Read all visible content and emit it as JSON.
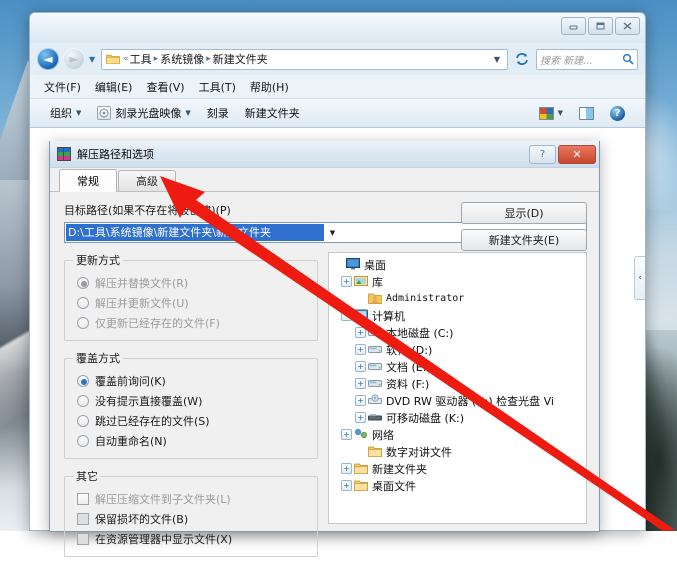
{
  "window": {
    "controls": {
      "minimize": "–",
      "maximize": "□",
      "close": "✕"
    },
    "address": {
      "chevron": "«",
      "crumbs": [
        "工具",
        "系统镜像",
        "新建文件夹"
      ],
      "separator": "▸",
      "dropdown_caret": "▼",
      "refresh_icon": "refresh-icon"
    },
    "search": {
      "placeholder": "搜索 新建...",
      "icon": "search-icon"
    },
    "menubar": [
      "文件(F)",
      "编辑(E)",
      "查看(V)",
      "工具(T)",
      "帮助(H)"
    ],
    "toolbar": {
      "organize": "组织",
      "burn_image": "刻录光盘映像",
      "burn": "刻录",
      "new_folder": "新建文件夹",
      "caret": "▼",
      "help_glyph": "?"
    },
    "pane_collapse_glyph": "‹"
  },
  "dialog": {
    "title": "解压路径和选项",
    "help_glyph": "?",
    "close_glyph": "✕",
    "tabs": [
      {
        "label": "常规",
        "active": true
      },
      {
        "label": "高级",
        "active": false
      }
    ],
    "path_label": "目标路径(如果不存在将被创建)(P)",
    "path_value": "D:\\工具\\系统镜像\\新建文件夹\\新建文件夹",
    "path_caret": "▼",
    "buttons": {
      "show": "显示(D)",
      "new_folder": "新建文件夹(E)"
    },
    "groups": {
      "update_mode": {
        "legend": "更新方式",
        "options": [
          {
            "label": "解压并替换文件(R)",
            "selected": true,
            "disabled": true
          },
          {
            "label": "解压并更新文件(U)",
            "selected": false,
            "disabled": true
          },
          {
            "label": "仅更新已经存在的文件(F)",
            "selected": false,
            "disabled": true
          }
        ]
      },
      "overwrite_mode": {
        "legend": "覆盖方式",
        "options": [
          {
            "label": "覆盖前询问(K)",
            "selected": true,
            "disabled": false
          },
          {
            "label": "没有提示直接覆盖(W)",
            "selected": false,
            "disabled": false
          },
          {
            "label": "跳过已经存在的文件(S)",
            "selected": false,
            "disabled": false
          },
          {
            "label": "自动重命名(N)",
            "selected": false,
            "disabled": false
          }
        ]
      },
      "other": {
        "legend": "其它",
        "options": [
          {
            "label": "解压压缩文件到子文件夹(L)",
            "checked": false,
            "disabled": true
          },
          {
            "label": "保留损坏的文件(B)",
            "checked": false,
            "disabled": false
          },
          {
            "label": "在资源管理器中显示文件(X)",
            "checked": false,
            "disabled": false
          }
        ]
      }
    },
    "tree": [
      {
        "label": "桌面",
        "indent": 0,
        "expander": "",
        "icon": "desktop-icon"
      },
      {
        "label": "库",
        "indent": 1,
        "expander": "+",
        "icon": "library-icon"
      },
      {
        "label": "Administrator",
        "indent": 1,
        "expander": "",
        "icon": "user-folder-icon",
        "mono": true
      },
      {
        "label": "计算机",
        "indent": 1,
        "expander": "-",
        "icon": "computer-icon"
      },
      {
        "label": "本地磁盘 (C:)",
        "indent": 2,
        "expander": "+",
        "icon": "drive-system-icon"
      },
      {
        "label": "软件 (D:)",
        "indent": 2,
        "expander": "+",
        "icon": "drive-icon"
      },
      {
        "label": "文档 (E:)",
        "indent": 2,
        "expander": "+",
        "icon": "drive-icon"
      },
      {
        "label": "资料 (F:)",
        "indent": 2,
        "expander": "+",
        "icon": "drive-icon"
      },
      {
        "label": "DVD RW 驱动器 (G:) 检查光盘 Vi",
        "indent": 2,
        "expander": "+",
        "icon": "dvd-icon"
      },
      {
        "label": "可移动磁盘 (K:)",
        "indent": 2,
        "expander": "+",
        "icon": "removable-icon"
      },
      {
        "label": "网络",
        "indent": 1,
        "expander": "+",
        "icon": "network-icon"
      },
      {
        "label": "数字对讲文件",
        "indent": 1,
        "expander": "",
        "icon": "folder-icon"
      },
      {
        "label": "新建文件夹",
        "indent": 1,
        "expander": "+",
        "icon": "folder-icon"
      },
      {
        "label": "桌面文件",
        "indent": 1,
        "expander": "+",
        "icon": "folder-icon"
      }
    ]
  },
  "colors": {
    "selection_blue": "#2f6fce",
    "radio_blue": "#2a76c8",
    "arrow_red": "#ee1b11",
    "close_red": "#c8452c"
  }
}
